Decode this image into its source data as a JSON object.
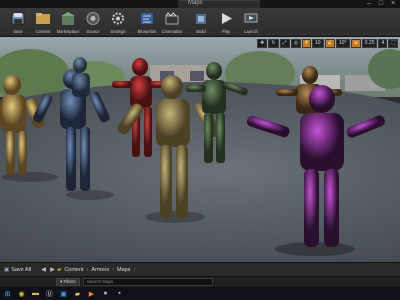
{
  "window": {
    "tab_title": "Maps"
  },
  "toolbar": {
    "items": [
      {
        "label": "Save",
        "icon": "save-icon"
      },
      {
        "label": "Content",
        "icon": "content-icon"
      },
      {
        "label": "Marketplace",
        "icon": "marketplace-icon"
      },
      {
        "label": "Source",
        "icon": "source-control-icon"
      },
      {
        "label": "Settings",
        "icon": "settings-icon"
      },
      {
        "label": "Blueprints",
        "icon": "blueprints-icon"
      },
      {
        "label": "Cinematics",
        "icon": "cinematics-icon"
      },
      {
        "label": "Build",
        "icon": "build-icon"
      },
      {
        "label": "Play",
        "icon": "play-icon"
      },
      {
        "label": "Launch",
        "icon": "launch-icon"
      }
    ]
  },
  "viewport": {
    "grid_snap": "10",
    "rotate_snap": "10°",
    "scale_snap": "0.25",
    "camera_speed": "4"
  },
  "content_browser": {
    "save_all_label": "Save All",
    "breadcrumbs": [
      "Content",
      "Armors",
      "Maps"
    ],
    "filters_label": "Filters",
    "search_placeholder": "Search Maps"
  },
  "taskbar": {
    "icons": [
      "windows-start-icon",
      "chrome-icon",
      "file-explorer-icon",
      "unreal-engine-icon",
      "photoshop-icon",
      "folder-icon",
      "media-icon",
      "steam-icon",
      "app-icon"
    ]
  },
  "colors": {
    "accent": "#c77a1a",
    "toolbar": "#333333",
    "background": "#232323"
  }
}
